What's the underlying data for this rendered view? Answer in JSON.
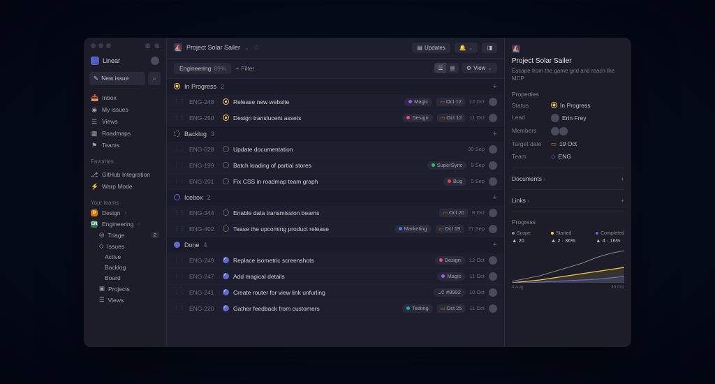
{
  "brand": "Linear",
  "new_issue_label": "New issue",
  "sidebar": {
    "nav": [
      {
        "icon": "📥",
        "label": "Inbox"
      },
      {
        "icon": "◉",
        "label": "My issues"
      },
      {
        "icon": "☰",
        "label": "Views"
      },
      {
        "icon": "▦",
        "label": "Roadmaps"
      },
      {
        "icon": "⚑",
        "label": "Teams"
      }
    ],
    "fav_label": "Favorites",
    "favorites": [
      {
        "icon": "⎇",
        "label": "GitHub Integration"
      },
      {
        "icon": "⚡",
        "label": "Warp Mode"
      }
    ],
    "teams_label": "Your teams",
    "teams": [
      {
        "badge_bg": "#d97706",
        "badge_txt": "D",
        "label": "Design"
      },
      {
        "badge_bg": "#3a7a5a",
        "badge_txt": "EN",
        "label": "Engineering"
      }
    ],
    "tree": [
      {
        "icon": "◎",
        "label": "Triage",
        "badge": "2"
      },
      {
        "icon": "◇",
        "label": "Issues"
      },
      {
        "label": "Active",
        "sub": true
      },
      {
        "label": "Backlog",
        "sub": true
      },
      {
        "label": "Board",
        "sub": true
      },
      {
        "icon": "▣",
        "label": "Projects"
      },
      {
        "icon": "☰",
        "label": "Views"
      }
    ]
  },
  "topbar": {
    "project": "Project Solar Sailer",
    "updates": "Updates"
  },
  "filterbar": {
    "team": "Engineering",
    "pct": "89%",
    "filter": "Filter",
    "view": "View"
  },
  "groups": [
    {
      "status": "progress",
      "name": "In Progress",
      "count": "2",
      "issues": [
        {
          "id": "ENG-248",
          "st": "yellow",
          "title": "Release new website",
          "tag": {
            "color": "#a855f7",
            "text": "Magic"
          },
          "pill": "Oct 12",
          "date": "12 Oct"
        },
        {
          "id": "ENG-250",
          "st": "yellow",
          "title": "Design translucent assets",
          "tag": {
            "color": "#ec4899",
            "text": "Design"
          },
          "pill": "Oct 12",
          "date": "11 Oct"
        }
      ]
    },
    {
      "status": "backlog",
      "name": "Backlog",
      "count": "3",
      "issues": [
        {
          "id": "ENG-028",
          "st": "gray",
          "title": "Update documentation",
          "date": "30 Sep"
        },
        {
          "id": "ENG-199",
          "st": "gray",
          "title": "Batch loading of partial stores",
          "tag": {
            "color": "#22c55e",
            "text": "SuperSync"
          },
          "date": "5 Sep"
        },
        {
          "id": "ENG-201",
          "st": "gray",
          "title": "Fix CSS in roadmap team graph",
          "tag": {
            "color": "#ef4444",
            "text": "Bug"
          },
          "date": "5 Sep"
        }
      ]
    },
    {
      "status": "icebox",
      "name": "Icebox",
      "count": "2",
      "issues": [
        {
          "id": "ENG-344",
          "st": "gray",
          "title": "Enable data transmission beams",
          "pill": "Oct 20",
          "date": "8 Oct"
        },
        {
          "id": "ENG-402",
          "st": "gray",
          "title": "Tease the upcoming product release",
          "tag": {
            "color": "#3b82f6",
            "text": "Marketing"
          },
          "pill": "Oct 19",
          "date": "27 Sep"
        }
      ]
    },
    {
      "status": "done",
      "name": "Done",
      "count": "4",
      "issues": [
        {
          "id": "ENG-249",
          "st": "done",
          "title": "Replace isometric screenshots",
          "tag": {
            "color": "#ec4899",
            "text": "Design"
          },
          "date": "12 Oct"
        },
        {
          "id": "ENG-247",
          "st": "done",
          "title": "Add magical details",
          "tag": {
            "color": "#a855f7",
            "text": "Magic"
          },
          "date": "11 Oct"
        },
        {
          "id": "ENG-241",
          "st": "done",
          "title": "Create router for view link unfurling",
          "pr": "#8992",
          "date": "10 Oct"
        },
        {
          "id": "ENG-220",
          "st": "done",
          "title": "Gather feedback from customers",
          "tag": {
            "color": "#14b8a6",
            "text": "Testing"
          },
          "pill": "Oct 25",
          "date": "11 Oct"
        }
      ]
    }
  ],
  "right": {
    "title": "Project Solar Sailer",
    "desc": "Escape from the game grid and reach the MCP",
    "properties_label": "Properties",
    "props": {
      "status": {
        "k": "Status",
        "v": "In Progress"
      },
      "lead": {
        "k": "Lead",
        "v": "Erin Frey"
      },
      "members": {
        "k": "Members"
      },
      "target": {
        "k": "Target date",
        "v": "19 Oct"
      },
      "team": {
        "k": "Team",
        "v": "ENG"
      }
    },
    "documents": "Documents",
    "links": "Links",
    "progress": "Progress",
    "legend": [
      {
        "color": "#888",
        "label": "Scope",
        "val": "20",
        "arrow": "▲"
      },
      {
        "color": "#f2c94c",
        "label": "Started",
        "val": "2 · 36%",
        "arrow": "▲"
      },
      {
        "color": "#5e6ad2",
        "label": "Completed",
        "val": "4 · 16%",
        "arrow": "▲"
      }
    ],
    "chart_dates": {
      "start": "4 Aug",
      "end": "30 Oct"
    }
  },
  "chart_data": {
    "type": "area",
    "x_range": [
      "4 Aug",
      "30 Oct"
    ],
    "series": [
      {
        "name": "Scope",
        "color": "#888",
        "values": [
          2,
          4,
          6,
          9,
          12,
          15,
          18,
          20
        ]
      },
      {
        "name": "Started",
        "color": "#f2c94c",
        "values": [
          0,
          1,
          2,
          3,
          4,
          5,
          6,
          7
        ]
      },
      {
        "name": "Completed",
        "color": "#5e6ad2",
        "values": [
          0,
          0,
          1,
          1,
          2,
          2,
          3,
          4
        ]
      }
    ]
  }
}
